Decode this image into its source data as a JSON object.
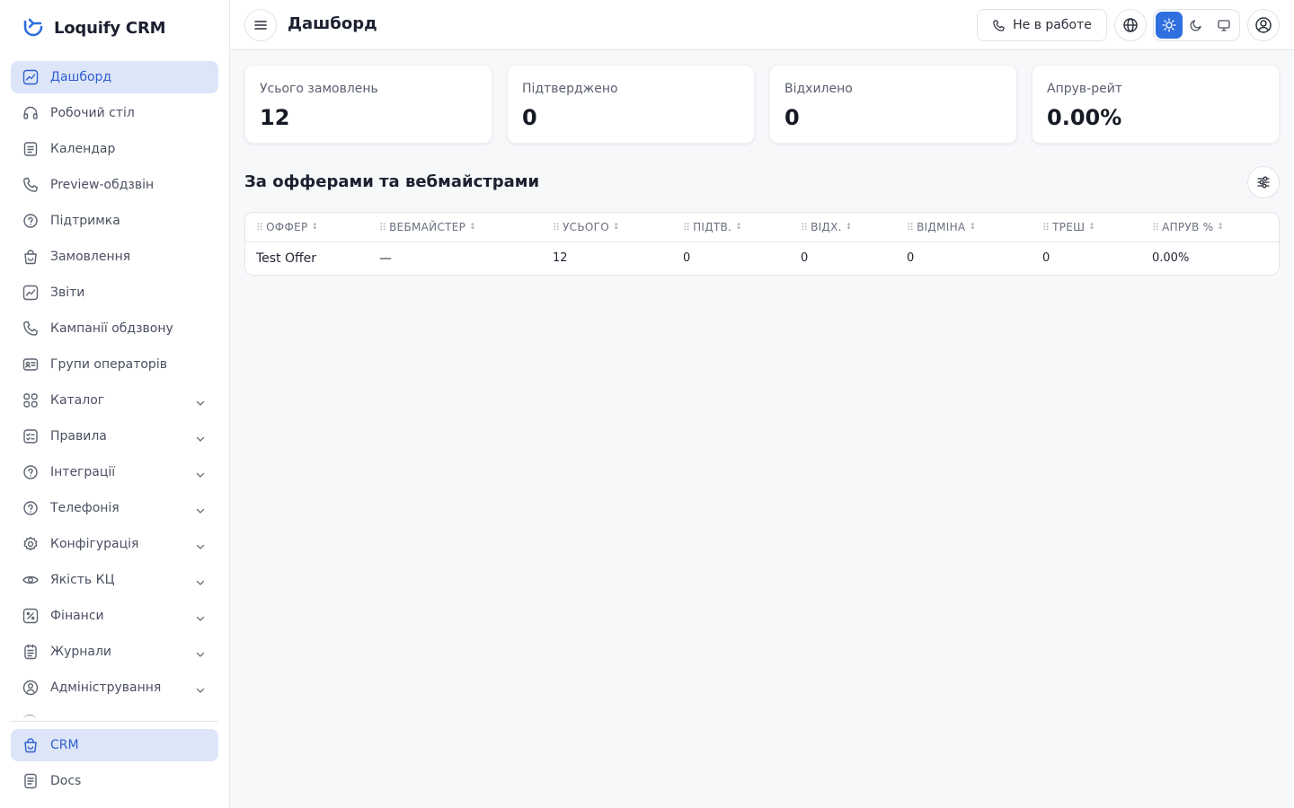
{
  "app": {
    "name": "Loquify CRM"
  },
  "sidebar": {
    "items": [
      {
        "label": "Дашборд",
        "icon": "dashboard-icon",
        "active": true,
        "expandable": false
      },
      {
        "label": "Робочий стіл",
        "icon": "headset-icon",
        "active": false,
        "expandable": false
      },
      {
        "label": "Календар",
        "icon": "calendar-icon",
        "active": false,
        "expandable": false
      },
      {
        "label": "Preview-обдзвін",
        "icon": "phone-icon",
        "active": false,
        "expandable": false
      },
      {
        "label": "Підтримка",
        "icon": "support-icon",
        "active": false,
        "expandable": false
      },
      {
        "label": "Замовлення",
        "icon": "shopping-bag-icon",
        "active": false,
        "expandable": false
      },
      {
        "label": "Звіти",
        "icon": "chart-icon",
        "active": false,
        "expandable": false
      },
      {
        "label": "Кампанії обдзвону",
        "icon": "phone-icon",
        "active": false,
        "expandable": false
      },
      {
        "label": "Групи операторів",
        "icon": "id-card-icon",
        "active": false,
        "expandable": false
      },
      {
        "label": "Каталог",
        "icon": "grid-icon",
        "active": false,
        "expandable": true
      },
      {
        "label": "Правила",
        "icon": "checklist-icon",
        "active": false,
        "expandable": true
      },
      {
        "label": "Інтеграції",
        "icon": "support-icon",
        "active": false,
        "expandable": true
      },
      {
        "label": "Телефонія",
        "icon": "support-icon",
        "active": false,
        "expandable": true
      },
      {
        "label": "Конфігурація",
        "icon": "gear-icon",
        "active": false,
        "expandable": true
      },
      {
        "label": "Якість КЦ",
        "icon": "eye-icon",
        "active": false,
        "expandable": true
      },
      {
        "label": "Фінанси",
        "icon": "percent-icon",
        "active": false,
        "expandable": true
      },
      {
        "label": "Журнали",
        "icon": "journal-icon",
        "active": false,
        "expandable": true
      },
      {
        "label": "Адміністрування",
        "icon": "user-shield-icon",
        "active": false,
        "expandable": true
      }
    ],
    "bottom_items": [
      {
        "label": "CRM",
        "icon": "shopping-bag-icon",
        "active": true
      },
      {
        "label": "Docs",
        "icon": "document-icon",
        "active": false
      }
    ]
  },
  "header": {
    "title": "Дашборд",
    "status_label": "Не в работе",
    "theme_selected": "light"
  },
  "stats": [
    {
      "label": "Усього замовлень",
      "value": "12"
    },
    {
      "label": "Підтверджено",
      "value": "0"
    },
    {
      "label": "Відхилено",
      "value": "0"
    },
    {
      "label": "Апрув-рейт",
      "value": "0.00%"
    }
  ],
  "section": {
    "title": "За офферами та вебмайстрами"
  },
  "table": {
    "columns": [
      "ОФФЕР",
      "ВЕБМАЙСТЕР",
      "УСЬОГО",
      "ПІДТВ.",
      "ВІДХ.",
      "ВІДМІНА",
      "ТРЕШ",
      "АПРУВ %"
    ],
    "rows": [
      [
        "Test Offer",
        "—",
        "12",
        "0",
        "0",
        "0",
        "0",
        "0.00%"
      ]
    ]
  },
  "colors": {
    "accent": "#2f6fe0",
    "active_bg": "#dde5f8",
    "active_text": "#2f5fd0"
  }
}
